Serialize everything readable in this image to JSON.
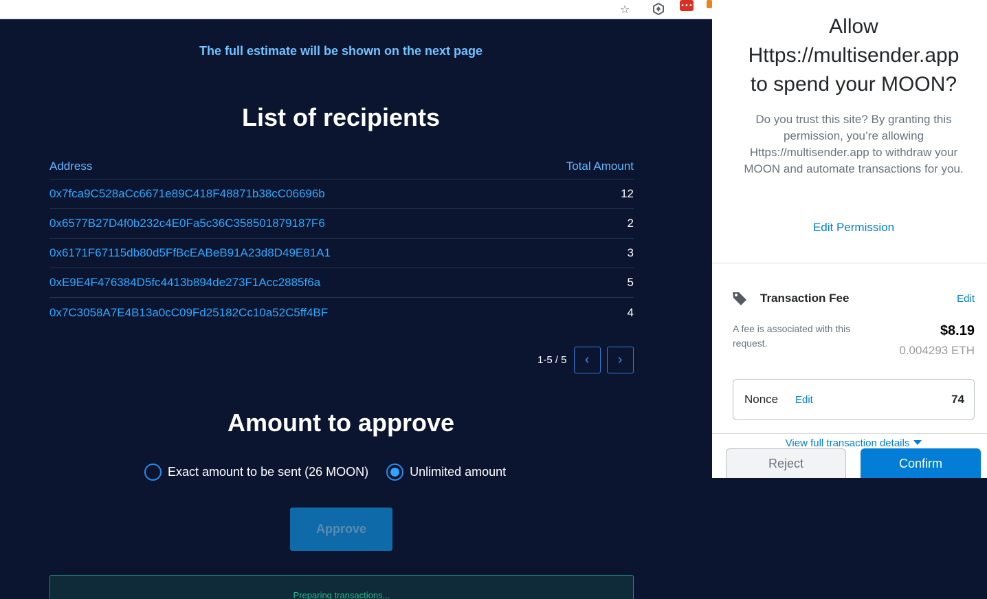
{
  "browser": {
    "star_icon": "star-icon",
    "extensions": [
      "binance-icon",
      "extension-red-icon",
      "metamask-fox-icon"
    ]
  },
  "main": {
    "estimate_note": "The full estimate will be shown on the next page",
    "list_title": "List of recipients",
    "table": {
      "headers": [
        "Address",
        "Total Amount"
      ],
      "rows": [
        {
          "address": "0x7fca9C528aCc6671e89C418F48871b38cC06696b",
          "amount": "12"
        },
        {
          "address": "0x6577B27D4f0b232c4E0Fa5c36C358501879187F6",
          "amount": "2"
        },
        {
          "address": "0x6171F67115db80d5FfBcEABeB91A23d8D49E81A1",
          "amount": "3"
        },
        {
          "address": "0xE9E4F476384D5fc4413b894de273F1Acc2885f6a",
          "amount": "5"
        },
        {
          "address": "0x7C3058A7E4B13a0cC09Fd25182Cc10a52C5ff4BF",
          "amount": "4"
        }
      ]
    },
    "pagination": {
      "range": "1-5 / 5",
      "prev_icon": "‹",
      "next_icon": "›"
    },
    "approve_title": "Amount to approve",
    "options": [
      {
        "label": "Exact amount to be sent (26 MOON)",
        "selected": false
      },
      {
        "label": "Unlimited amount",
        "selected": true
      }
    ],
    "approve_button": "Approve",
    "status": "Preparing transactions..."
  },
  "popup": {
    "title_line1": "Allow",
    "title_line2": "Https://multisender.app",
    "title_line3": "to spend your MOON?",
    "description": "Do you trust this site? By granting this permission, you’re allowing Https://multisender.app to withdraw your MOON and automate transactions for you.",
    "edit_permission": "Edit Permission",
    "fee": {
      "title": "Transaction Fee",
      "edit": "Edit",
      "description": "A fee is associated with this request.",
      "usd": "$8.19",
      "eth": "0.004293 ETH"
    },
    "nonce": {
      "label": "Nonce",
      "edit": "Edit",
      "value": "74"
    },
    "view_details": "View full transaction details",
    "reject": "Reject",
    "confirm": "Confirm"
  },
  "colors": {
    "page_bg": "#0b1530",
    "accent_blue": "#2fa8ff",
    "metamask_blue": "#037dd6",
    "status_green": "#25b88e"
  }
}
